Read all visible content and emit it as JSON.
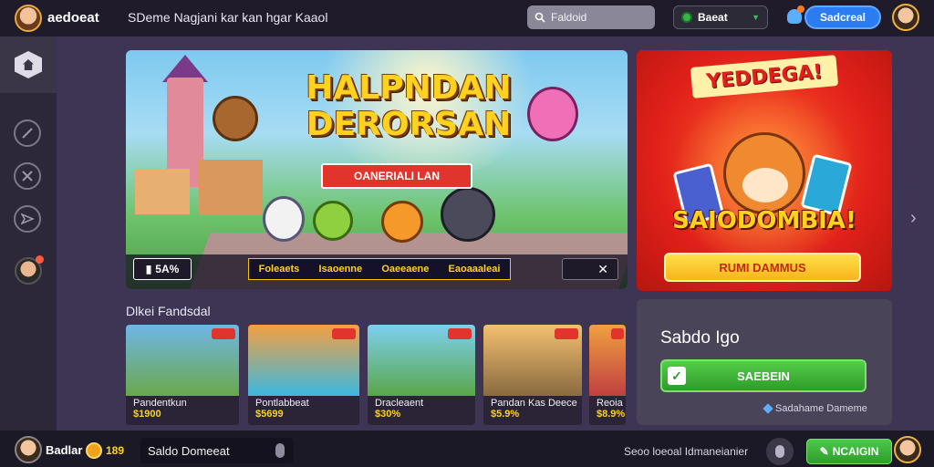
{
  "header": {
    "logo_text": "aedoeat",
    "tagline": "SDeme Nagjani kar kan hgar Kaaol",
    "search_placeholder": "Faldoid",
    "language_select": "Baeat",
    "primary_button": "Sadcreal"
  },
  "hero": {
    "title_line1": "HALPNDAN",
    "title_line2": "DERORSAN",
    "ribbon": "OANERIALI LAN",
    "badge": "5A%",
    "ticker": [
      "Foleaets",
      "Isaoenne",
      "Oaeeaene",
      "Eaoaaaleai"
    ]
  },
  "promo": {
    "title": "YEDDEGA!",
    "subtitle": "SAIODOMBIA!",
    "button": "RUMI DAMMUS"
  },
  "section": {
    "title": "Dlkei Fandsdal"
  },
  "games": [
    {
      "name": "Pandentkun",
      "price": "$1900"
    },
    {
      "name": "Pontlabbeat",
      "price": "$5699"
    },
    {
      "name": "Dracleaent",
      "price": "$30%"
    },
    {
      "name": "Pandan Kas Deece",
      "price": "$5.9%"
    },
    {
      "name": "Reoia",
      "price": "$8.9%"
    }
  ],
  "balance": {
    "title": "Sabdo Igo",
    "button": "SAEBEIN",
    "note": "Sadahame Dameme"
  },
  "footer": {
    "user": "Badlar",
    "coins": "189",
    "input_placeholder": "Saldo Domeeat",
    "status": "Seoo loeoal Idmaneianier",
    "button": "NCAIGIN"
  },
  "colors": {
    "topbar": "#1f1b2b",
    "page": "#3d3553",
    "accent_blue": "#2a7cf0",
    "accent_green": "#38b54a",
    "accent_gold": "#ffd21f",
    "accent_red": "#e0342c"
  },
  "icons": {
    "home": "home-icon",
    "side": [
      "compass-icon",
      "crossed-swords-icon",
      "send-icon"
    ],
    "next": "chevron-right-icon"
  }
}
